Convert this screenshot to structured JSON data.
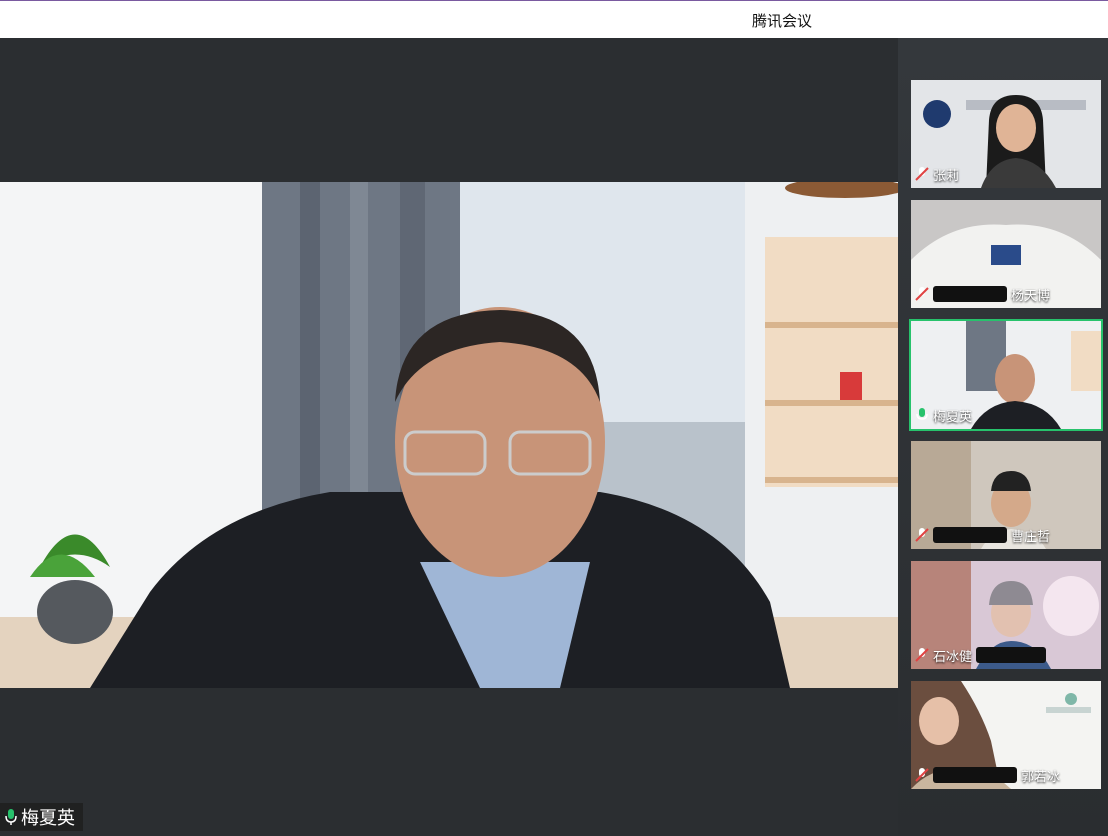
{
  "window": {
    "title": "腾讯会议"
  },
  "main_video": {
    "speaker_name": "梅夏英",
    "mic_state": "unmuted"
  },
  "participants": [
    {
      "name": "张莉",
      "mic_state": "muted",
      "active": false
    },
    {
      "name": "杨天博",
      "mic_state": "muted",
      "active": false,
      "name_redacted_prefix": true
    },
    {
      "name": "梅夏英",
      "mic_state": "unmuted",
      "active": true
    },
    {
      "name": "曹庄哲",
      "mic_state": "muted",
      "active": false,
      "name_redacted_prefix": true
    },
    {
      "name": "石冰健",
      "mic_state": "muted",
      "active": false,
      "name_redacted_suffix": true
    },
    {
      "name": "郭若冰",
      "mic_state": "muted",
      "active": false,
      "name_redacted_prefix": true
    }
  ],
  "colors": {
    "accent_active": "#27c26c",
    "mic_muted": "#e04343",
    "mic_unmuted": "#27c26c"
  }
}
